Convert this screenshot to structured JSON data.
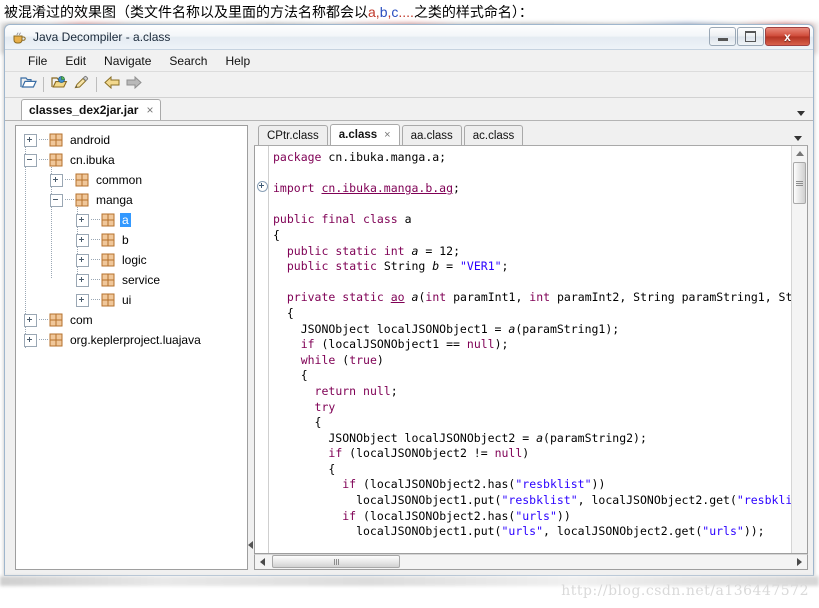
{
  "caption": {
    "pre": "被混淆过的效果图（类文件名称以及里面的方法名称都会以",
    "a": "a",
    "comma1": ",",
    "b": "b",
    "comma2": ",",
    "c": "c",
    "dots": "....",
    "post": "之类的样式命名）："
  },
  "window": {
    "title": "Java Decompiler - a.class",
    "icon": "java-coffee-cup-icon",
    "buttons": {
      "minimize": "minimize-button",
      "maximize": "maximize-button",
      "close_label": "x"
    }
  },
  "menubar": {
    "items": [
      {
        "label": "File"
      },
      {
        "label": "Edit"
      },
      {
        "label": "Navigate"
      },
      {
        "label": "Search"
      },
      {
        "label": "Help"
      }
    ]
  },
  "toolbar": {
    "buttons": [
      {
        "icon": "open-folder-icon"
      },
      {
        "icon": "open-type-icon"
      },
      {
        "icon": "pencil-icon"
      },
      {
        "icon": "back-arrow-icon"
      },
      {
        "icon": "forward-arrow-icon"
      }
    ]
  },
  "jar_tabs": {
    "tabs": [
      {
        "label": "classes_dex2jar.jar",
        "close": "×"
      }
    ],
    "overflow": "chevron-down-icon"
  },
  "tree": {
    "nodes": [
      {
        "label": "android",
        "indent": 0,
        "expander": "plus",
        "selected": false
      },
      {
        "label": "cn.ibuka",
        "indent": 0,
        "expander": "minus",
        "selected": false
      },
      {
        "label": "common",
        "indent": 1,
        "expander": "plus",
        "selected": false
      },
      {
        "label": "manga",
        "indent": 1,
        "expander": "minus",
        "selected": false
      },
      {
        "label": "a",
        "indent": 2,
        "expander": "plus",
        "selected": true
      },
      {
        "label": "b",
        "indent": 2,
        "expander": "plus",
        "selected": false
      },
      {
        "label": "logic",
        "indent": 2,
        "expander": "plus",
        "selected": false
      },
      {
        "label": "service",
        "indent": 2,
        "expander": "plus",
        "selected": false
      },
      {
        "label": "ui",
        "indent": 2,
        "expander": "plus",
        "selected": false
      },
      {
        "label": "com",
        "indent": 0,
        "expander": "plus",
        "selected": false
      },
      {
        "label": "org.keplerproject.luajava",
        "indent": 0,
        "expander": "plus",
        "selected": false
      }
    ]
  },
  "class_tabs": {
    "tabs": [
      {
        "label": "CPtr.class",
        "active": false,
        "close": ""
      },
      {
        "label": "a.class",
        "active": true,
        "close": "×"
      },
      {
        "label": "aa.class",
        "active": false,
        "close": ""
      },
      {
        "label": "ac.class",
        "active": false,
        "close": ""
      }
    ],
    "overflow": "chevron-down-icon"
  },
  "code": {
    "lines": [
      "package cn.ibuka.manga.a;",
      "",
      "import cn.ibuka.manga.b.ag;",
      "",
      "public final class a",
      "{",
      "  public static int a = 12;",
      "  public static String b = \"VER1\";",
      "",
      "  private static ao a(int paramInt1, int paramInt2, String paramString1, St",
      "  {",
      "    JSONObject localJSONObject1 = a(paramString1);",
      "    if (localJSONObject1 == null);",
      "    while (true)",
      "    {",
      "      return null;",
      "      try",
      "      {",
      "        JSONObject localJSONObject2 = a(paramString2);",
      "        if (localJSONObject2 != null)",
      "        {",
      "          if (localJSONObject2.has(\"resbklist\"))",
      "            localJSONObject1.put(\"resbklist\", localJSONObject2.get(\"resbkli",
      "          if (localJSONObject2.has(\"urls\"))",
      "            localJSONObject1.put(\"urls\", localJSONObject2.get(\"urls\"));"
    ]
  },
  "scrollbars": {
    "vertical": "editor-vertical-scrollbar",
    "horizontal": "editor-horizontal-scrollbar"
  },
  "watermark": "http://blog.csdn.net/a136447572",
  "colors": {
    "keyword": "#7f0055",
    "string": "#2a00ff",
    "selection": "#3399ff",
    "titlebar_close": "#cf4a38"
  }
}
